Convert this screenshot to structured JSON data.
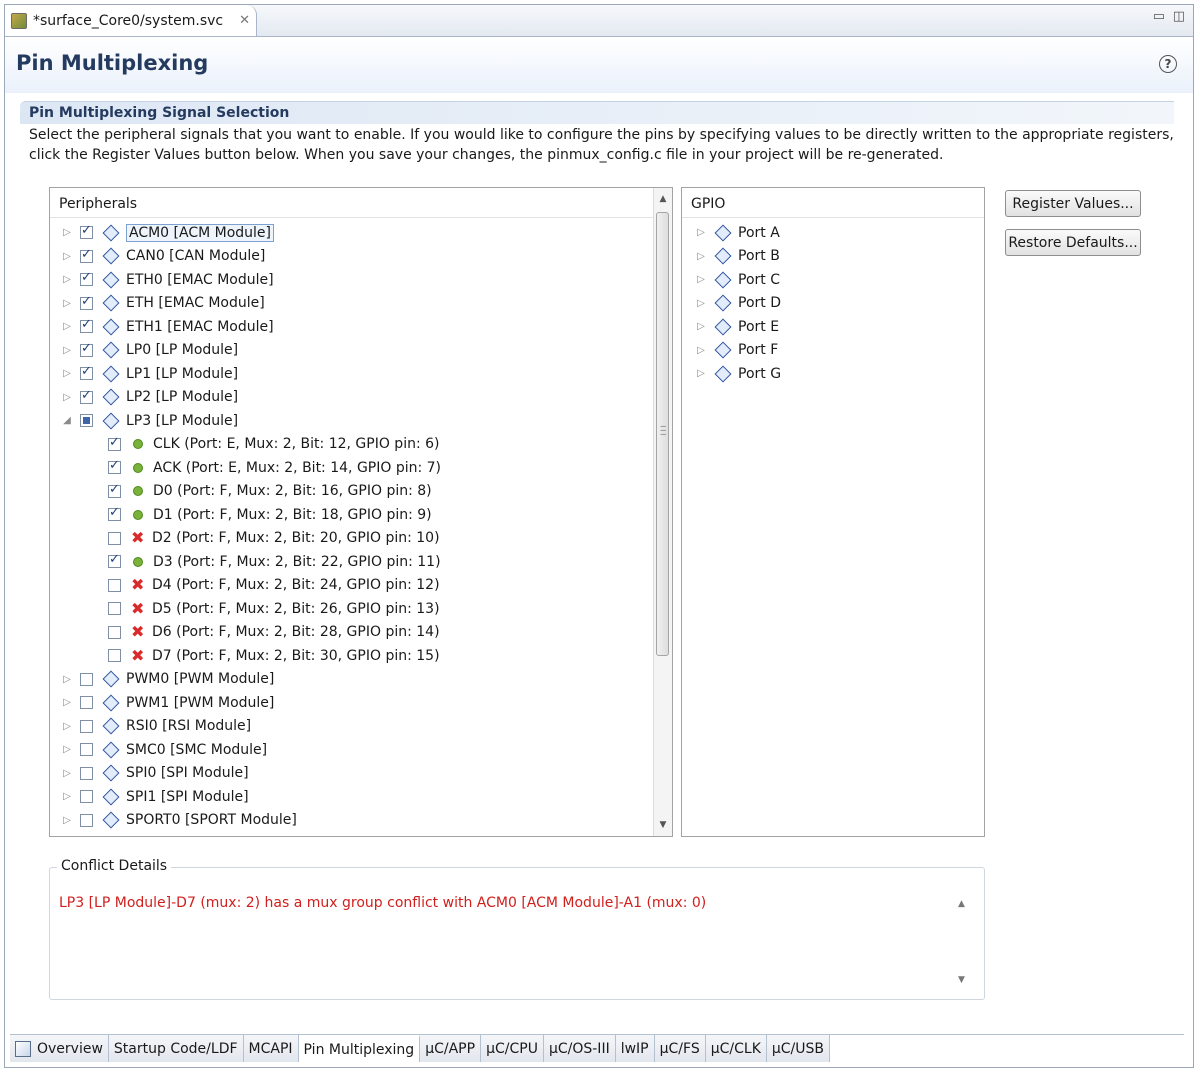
{
  "editor_tab": {
    "title": "*surface_Core0/system.svc"
  },
  "header": {
    "title": "Pin Multiplexing"
  },
  "section": {
    "title": "Pin Multiplexing Signal Selection",
    "description_line1": "Select the peripheral signals that you want to enable.  If you would like to configure the pins by specifying values to be directly written to the appropriate registers,",
    "description_line2": "click the Register Values button below.  When you save your changes, the pinmux_config.c file in your project will be re-generated."
  },
  "peripherals": {
    "header": "Peripherals",
    "items": [
      {
        "label": "ACM0 [ACM Module]",
        "state": "checked",
        "expander": "collapsed",
        "selected": true
      },
      {
        "label": "CAN0 [CAN Module]",
        "state": "checked",
        "expander": "collapsed"
      },
      {
        "label": "ETH0 [EMAC Module]",
        "state": "checked",
        "expander": "collapsed"
      },
      {
        "label": "ETH [EMAC Module]",
        "state": "checked",
        "expander": "collapsed"
      },
      {
        "label": "ETH1 [EMAC Module]",
        "state": "checked",
        "expander": "collapsed"
      },
      {
        "label": "LP0 [LP Module]",
        "state": "checked",
        "expander": "collapsed"
      },
      {
        "label": "LP1 [LP Module]",
        "state": "checked",
        "expander": "collapsed"
      },
      {
        "label": "LP2 [LP Module]",
        "state": "checked",
        "expander": "collapsed"
      },
      {
        "label": "LP3 [LP Module]",
        "state": "partial",
        "expander": "expanded"
      },
      {
        "label": "CLK (Port: E, Mux: 2, Bit: 12, GPIO pin: 6)",
        "state": "checked",
        "child": true,
        "status": "ok"
      },
      {
        "label": "ACK (Port: E, Mux: 2, Bit: 14, GPIO pin: 7)",
        "state": "checked",
        "child": true,
        "status": "ok"
      },
      {
        "label": "D0 (Port: F, Mux: 2, Bit: 16, GPIO pin: 8)",
        "state": "checked",
        "child": true,
        "status": "ok"
      },
      {
        "label": "D1 (Port: F, Mux: 2, Bit: 18, GPIO pin: 9)",
        "state": "checked",
        "child": true,
        "status": "ok"
      },
      {
        "label": "D2 (Port: F, Mux: 2, Bit: 20, GPIO pin: 10)",
        "state": "unchecked",
        "child": true,
        "status": "conflict"
      },
      {
        "label": "D3 (Port: F, Mux: 2, Bit: 22, GPIO pin: 11)",
        "state": "checked",
        "child": true,
        "status": "ok"
      },
      {
        "label": "D4 (Port: F, Mux: 2, Bit: 24, GPIO pin: 12)",
        "state": "unchecked",
        "child": true,
        "status": "conflict"
      },
      {
        "label": "D5 (Port: F, Mux: 2, Bit: 26, GPIO pin: 13)",
        "state": "unchecked",
        "child": true,
        "status": "conflict"
      },
      {
        "label": "D6 (Port: F, Mux: 2, Bit: 28, GPIO pin: 14)",
        "state": "unchecked",
        "child": true,
        "status": "conflict"
      },
      {
        "label": "D7 (Port: F, Mux: 2, Bit: 30, GPIO pin: 15)",
        "state": "unchecked",
        "child": true,
        "status": "conflict"
      },
      {
        "label": "PWM0 [PWM Module]",
        "state": "unchecked",
        "expander": "collapsed"
      },
      {
        "label": "PWM1 [PWM Module]",
        "state": "unchecked",
        "expander": "collapsed"
      },
      {
        "label": "RSI0 [RSI Module]",
        "state": "unchecked",
        "expander": "collapsed"
      },
      {
        "label": "SMC0 [SMC Module]",
        "state": "unchecked",
        "expander": "collapsed"
      },
      {
        "label": "SPI0 [SPI Module]",
        "state": "unchecked",
        "expander": "collapsed"
      },
      {
        "label": "SPI1 [SPI Module]",
        "state": "unchecked",
        "expander": "collapsed"
      },
      {
        "label": "SPORT0 [SPORT Module]",
        "state": "unchecked",
        "expander": "collapsed"
      }
    ]
  },
  "gpio": {
    "header": "GPIO",
    "items": [
      "Port A",
      "Port B",
      "Port C",
      "Port D",
      "Port E",
      "Port F",
      "Port G"
    ]
  },
  "buttons": {
    "register_values": "Register Values...",
    "restore_defaults": "Restore Defaults..."
  },
  "conflict_details": {
    "title": "Conflict Details",
    "message": "LP3 [LP Module]-D7 (mux: 2) has a mux group conflict with ACM0 [ACM Module]-A1 (mux: 0)",
    "message_color": "#d0201e"
  },
  "bottom_tabs": [
    {
      "label": "Overview",
      "icon": "overview-icon"
    },
    {
      "label": "Startup Code/LDF"
    },
    {
      "label": "MCAPI"
    },
    {
      "label": "Pin Multiplexing",
      "active": true
    },
    {
      "label": "µC/APP"
    },
    {
      "label": "µC/CPU"
    },
    {
      "label": "µC/OS-III"
    },
    {
      "label": "lwIP"
    },
    {
      "label": "µC/FS"
    },
    {
      "label": "µC/CLK"
    },
    {
      "label": "µC/USB"
    }
  ]
}
